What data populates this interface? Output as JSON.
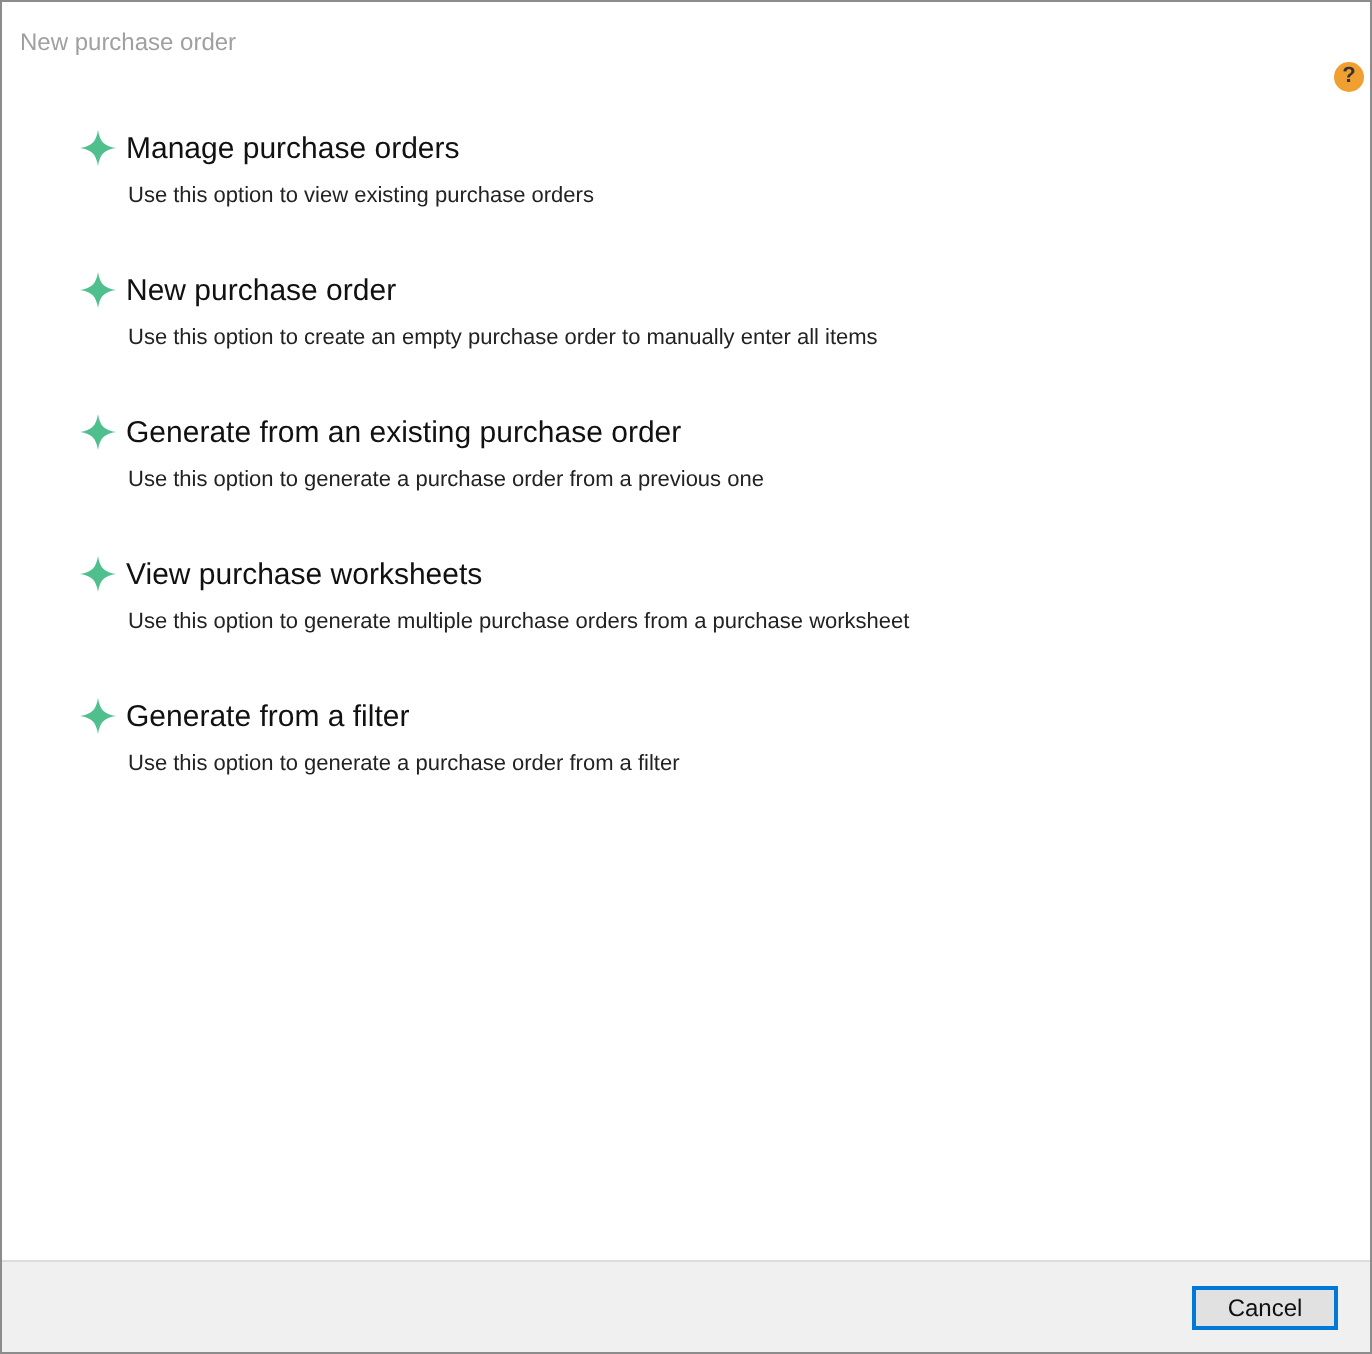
{
  "window": {
    "title": "New purchase order"
  },
  "help": "?",
  "options": [
    {
      "title": "Manage purchase orders",
      "description": "Use this option to view existing purchase orders"
    },
    {
      "title": "New purchase order",
      "description": "Use this option to create an empty purchase order to manually enter all items"
    },
    {
      "title": "Generate from an existing purchase order",
      "description": "Use this option to generate a purchase order from a previous one"
    },
    {
      "title": "View purchase worksheets",
      "description": "Use this option to generate multiple purchase orders from a purchase worksheet"
    },
    {
      "title": "Generate from a filter",
      "description": "Use this option to generate a purchase order from a filter"
    }
  ],
  "buttons": [
    "Cancel"
  ]
}
